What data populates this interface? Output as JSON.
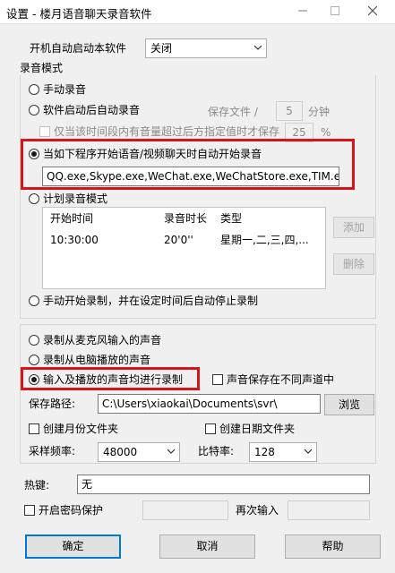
{
  "window": {
    "title": "设置 - 楼月语音聊天录音软件"
  },
  "startup": {
    "label": "开机自动启动本软件",
    "value": "关闭"
  },
  "record_mode": {
    "group_label": "录音模式",
    "manual": "手动录音",
    "auto_after_start": "软件启动后自动录音",
    "save_file_label": "保存文件 /",
    "save_file_value": "5",
    "minutes_label": "分钟",
    "threshold_label": "仅当该时间段内有音量超过后方指定值时才保存",
    "threshold_value": "25",
    "percent": "%",
    "auto_on_program": "当如下程序开始语音/视频聊天时自动开始录音",
    "program_list": "QQ.exe,Skype.exe,WeChat.exe,WeChatStore.exe,TIM.exe",
    "schedule": "计划录音模式",
    "manual_start_auto_stop": "手动开始录制，并在设定时间后自动停止录制"
  },
  "schedule_table": {
    "columns": [
      "开始时间",
      "录音时长",
      "类型"
    ],
    "rows": [
      {
        "start": "10:30:00",
        "duration": "20'0''",
        "type": "星期一,二,三,四,..."
      }
    ],
    "add_button": "添加",
    "delete_button": "删除"
  },
  "source": {
    "mic": "录制从麦克风输入的声音",
    "speaker": "录制从电脑播放的声音",
    "both": "输入及播放的声音均进行录制",
    "separate_channels": "声音保存在不同声道中"
  },
  "save": {
    "path_label": "保存路径:",
    "path_value": "C:\\Users\\xiaokai\\Documents\\svr\\",
    "browse_button": "浏览",
    "month_folder": "创建月份文件夹",
    "date_folder": "创建日期文件夹",
    "sample_rate_label": "采样频率:",
    "sample_rate_value": "48000",
    "bitrate_label": "比特率:",
    "bitrate_value": "128"
  },
  "hotkey": {
    "label": "热键:",
    "value": "无"
  },
  "password": {
    "enable_label": "开启密码保护",
    "repeat_label": "再次输入"
  },
  "buttons": {
    "ok": "确定",
    "cancel": "取消",
    "help": "帮助"
  },
  "colors": {
    "highlight": "#d7141c",
    "focus": "#0078d7"
  }
}
